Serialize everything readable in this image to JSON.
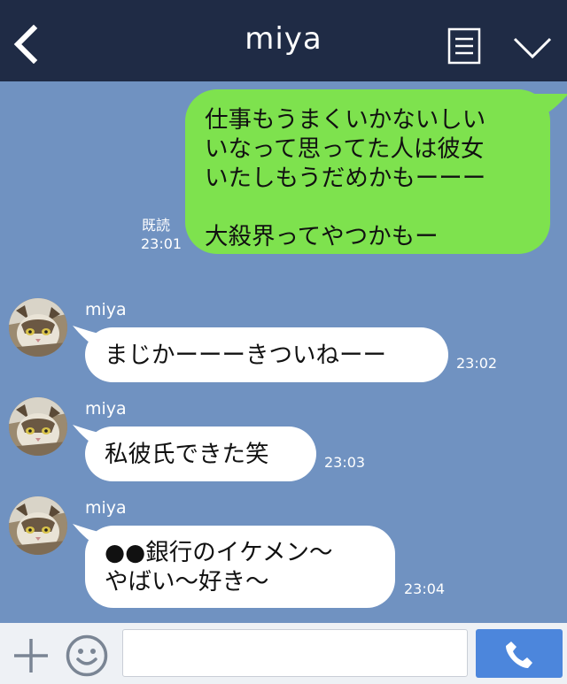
{
  "header": {
    "title": "miya",
    "back_icon": "chevron-left-icon",
    "notes_icon": "notes-icon",
    "menu_icon": "chevron-down-icon"
  },
  "messages": {
    "sent": {
      "lines": [
        "仕事もうまくいかないしい",
        "いなって思ってた人は彼女",
        "いたしもうだめかもーーー",
        "",
        "大殺界ってやつかもー"
      ],
      "read_label": "既読",
      "time": "23:01",
      "bubble_color": "#7ee24e"
    },
    "received": [
      {
        "sender": "miya",
        "lines": [
          "まじかーーーきついねーー"
        ],
        "time": "23:02"
      },
      {
        "sender": "miya",
        "lines": [
          "私彼氏できた笑"
        ],
        "time": "23:03"
      },
      {
        "sender": "miya",
        "lines": [
          "●●銀行のイケメン〜",
          "やばい〜好き〜"
        ],
        "time": "23:04"
      }
    ]
  },
  "composer": {
    "input_value": "",
    "plus_icon": "plus-icon",
    "emoji_icon": "smile-icon",
    "call_icon": "phone-icon",
    "accent_color": "#4c86dc"
  },
  "colors": {
    "chat_background": "#7092c1",
    "header_background": "#1f2b45"
  }
}
